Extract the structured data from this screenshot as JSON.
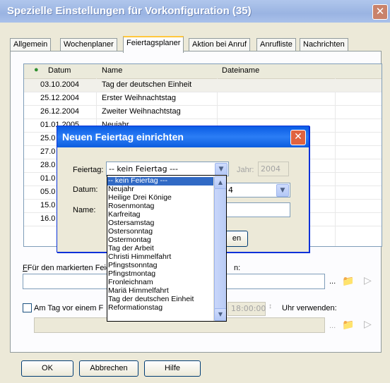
{
  "window": {
    "title": "Spezielle Einstellungen für Vorkonfiguration (35)",
    "close": "✕"
  },
  "tabs": [
    "Allgemein",
    "Wochenplaner",
    "Feiertagsplaner",
    "Aktion bei Anruf",
    "Anrufliste",
    "Nachrichten"
  ],
  "table": {
    "headers": {
      "date": "Datum",
      "name": "Name",
      "file": "Dateiname"
    },
    "rows": [
      {
        "date": "03.10.2004",
        "name": "Tag der deutschen Einheit"
      },
      {
        "date": "25.12.2004",
        "name": "Erster Weihnachtstag"
      },
      {
        "date": "26.12.2004",
        "name": "Zweiter Weihnachtstag"
      },
      {
        "date": "01.01.2005",
        "name": "Neujahr"
      },
      {
        "date": "25.0",
        "name": ""
      },
      {
        "date": "27.0",
        "name": ""
      },
      {
        "date": "28.0",
        "name": ""
      },
      {
        "date": "01.0",
        "name": ""
      },
      {
        "date": "05.0",
        "name": ""
      },
      {
        "date": "15.0",
        "name": ""
      },
      {
        "date": "16.0",
        "name": ""
      }
    ]
  },
  "file_section": {
    "label": "Für den markierten Feiertag",
    "label_tail": "n:",
    "browse": "..."
  },
  "day_before": {
    "label": "Am Tag vor einem F",
    "time": "18:00:00",
    "use_label": "Uhr verwenden:",
    "browse": "..."
  },
  "buttons": {
    "ok": "OK",
    "cancel": "Abbrechen",
    "help": "Hilfe"
  },
  "dialog": {
    "title": "Neuen Feiertag einrichten",
    "close": "✕",
    "holiday_label": "Feiertag:",
    "holiday_value": "-- kein Feiertag ---",
    "year_label": "Jahr:",
    "year_value": "2004",
    "date_label": "Datum:",
    "date_value_tail": "4",
    "name_label": "Name:",
    "button_tail": "en"
  },
  "dropdown_options": [
    "-- kein Feiertag ---",
    "Neujahr",
    "Heilige Drei Könige",
    "Rosenmontag",
    "Karfreitag",
    "Ostersamstag",
    "Ostersonntag",
    "Ostermontag",
    "Tag der Arbeit",
    "Christi Himmelfahrt",
    "Pfingstsonntag",
    "Pfingstmontag",
    "Fronleichnam",
    "Mariä Himmelfahrt",
    "Tag der deutschen Einheit",
    "Reformationstag"
  ],
  "colors": {
    "accent": "#316ac5",
    "dialog_title": "#0a5ce4",
    "tab_highlight": "#ffc73c"
  }
}
